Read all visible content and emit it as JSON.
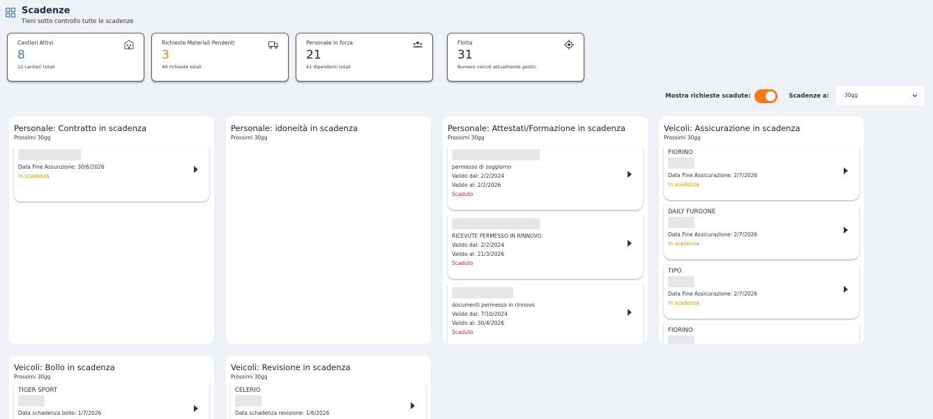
{
  "header": {
    "title": "Scadenze",
    "subtitle": "Tieni sotto controllo tutte le scadenze",
    "icon": "dashboard-icon"
  },
  "stats": [
    {
      "label": "Cantieri Attivi",
      "value": "8",
      "sub": "12 cantieri totali",
      "icon": "building-icon",
      "color": "#4a6fb5"
    },
    {
      "label": "Richieste Materiali Pendenti",
      "value": "3",
      "sub": "49 richieste totali",
      "icon": "truck-icon",
      "color": "#f07b1a"
    },
    {
      "label": "Personale in forza",
      "value": "21",
      "sub": "41 dipendenti totali",
      "icon": "people-icon",
      "color": "#222222"
    },
    {
      "label": "Flotta",
      "value": "31",
      "sub": "Numero veicoli attualmente gestiti",
      "icon": "target-icon",
      "color": "#222222"
    }
  ],
  "controls": {
    "show_expired_label": "Mostra richieste scadute:",
    "show_expired": true,
    "deadlines_label": "Scadenze a:",
    "deadlines_value": "30gg"
  },
  "panels": [
    {
      "title": "Personale: Contratto in scadenza",
      "sub": "Prossimi 30gg",
      "items": [
        {
          "lines": [
            "Data Fine Assunzione: 30/6/2026"
          ],
          "status": "In scadenza",
          "status_type": "warn"
        }
      ]
    },
    {
      "title": "Personale: idoneità  in scadenza",
      "sub": "Prossimi 30gg",
      "items": []
    },
    {
      "title": "Personale: Attestati/Formazione in scadenza",
      "sub": "Prossimi 30gg",
      "items": [
        {
          "lines": [
            "permesso di soggiorno",
            "Valido dal: 2/2/2024",
            "Valido al: 2/2/2026"
          ],
          "status": "Scaduto",
          "status_type": "exp"
        },
        {
          "lines": [
            "RICEVUTE PERMESSO IN RINNOVO",
            "Valido dal: 2/2/2024",
            "Valido al: 21/3/2026"
          ],
          "status": "Scaduto",
          "status_type": "exp"
        },
        {
          "lines": [
            "documenti permesso in rinnovo",
            "Valido dal: 7/10/2024",
            "Valido al: 30/4/2026"
          ],
          "status": "Scaduto",
          "status_type": "exp"
        }
      ]
    },
    {
      "title": "Veicoli: Assicurazione in scadenza",
      "sub": "Prossimi 30gg",
      "items": [
        {
          "name": "FIORINO",
          "lines": [
            "Data Fine Assicurazione: 2/7/2026"
          ],
          "status": "In scadenza",
          "status_type": "warn"
        },
        {
          "name": "DAILY FURGONE",
          "lines": [
            "Data Fine Assicurazione: 2/7/2026"
          ],
          "status": "In scadenza",
          "status_type": "warn"
        },
        {
          "name": "TIPO",
          "lines": [
            "Data Fine Assicurazione: 2/7/2026"
          ],
          "status": "In scadenza",
          "status_type": "warn"
        },
        {
          "name": "FIORINO",
          "lines": [],
          "status": "",
          "status_type": "warn"
        }
      ]
    },
    {
      "title": "Veicoli: Bollo in scadenza",
      "sub": "Prossimi 30gg",
      "items": [
        {
          "name": "TIGER SPORT",
          "lines": [
            "Data schadenza bollo: 1/7/2026"
          ],
          "status": "",
          "status_type": "warn"
        }
      ]
    },
    {
      "title": "Veicoli: Revisione in scadenza",
      "sub": "Prossimi 30gg",
      "items": [
        {
          "name": "CELERIO",
          "lines": [
            "Data schadenza revisione: 1/6/2026"
          ],
          "status": "",
          "status_type": "warn"
        }
      ]
    }
  ]
}
